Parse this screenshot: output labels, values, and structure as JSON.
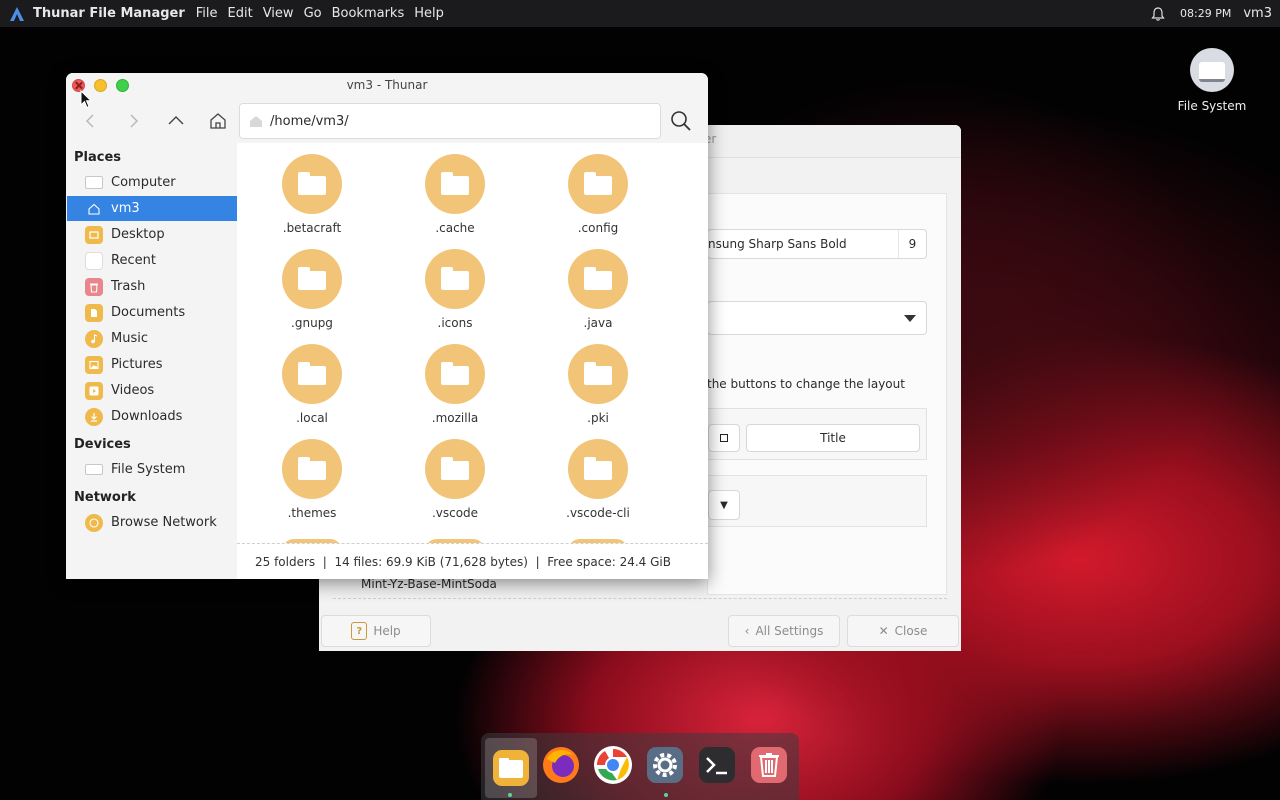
{
  "top_panel": {
    "app_title": "Thunar File Manager",
    "menu": [
      "File",
      "Edit",
      "View",
      "Go",
      "Bookmarks",
      "Help"
    ],
    "clock": "08:29 PM",
    "user": "vm3"
  },
  "desktop": {
    "icons": [
      {
        "label": "File System",
        "icon": "drive-icon"
      }
    ]
  },
  "settings_window": {
    "title_fragment": "er",
    "font_name": "nsung Sharp Sans Bold",
    "font_size": "9",
    "layout_hint": "the buttons to change the layout",
    "title_button": "Title",
    "theme_name": "Mint-Yz-Base-MintSoda",
    "buttons": {
      "help": "Help",
      "all_settings": "All Settings",
      "close": "Close"
    }
  },
  "thunar": {
    "title": "vm3 - Thunar",
    "path": "/home/vm3/",
    "sidebar": {
      "places_header": "Places",
      "places": [
        {
          "label": "Computer",
          "icon": "computer-icon"
        },
        {
          "label": "vm3",
          "icon": "home-icon",
          "selected": true
        },
        {
          "label": "Desktop",
          "icon": "desktop-icon"
        },
        {
          "label": "Recent",
          "icon": "recent-icon"
        },
        {
          "label": "Trash",
          "icon": "trash-icon"
        },
        {
          "label": "Documents",
          "icon": "documents-icon"
        },
        {
          "label": "Music",
          "icon": "music-icon"
        },
        {
          "label": "Pictures",
          "icon": "pictures-icon"
        },
        {
          "label": "Videos",
          "icon": "videos-icon"
        },
        {
          "label": "Downloads",
          "icon": "downloads-icon"
        }
      ],
      "devices_header": "Devices",
      "devices": [
        {
          "label": "File System",
          "icon": "drive-icon"
        }
      ],
      "network_header": "Network",
      "network": [
        {
          "label": "Browse Network",
          "icon": "network-icon"
        }
      ]
    },
    "folders": [
      ".betacraft",
      ".cache",
      ".config",
      ".gnupg",
      ".icons",
      ".java",
      ".local",
      ".mozilla",
      ".pki",
      ".themes",
      ".vscode",
      ".vscode-cli"
    ],
    "status": "25 folders  |  14 files: 69.9 KiB (71,628 bytes)  |  Free space: 24.4 GiB"
  },
  "dock": {
    "apps": [
      "files-icon",
      "firefox-icon",
      "chrome-icon",
      "settings-icon",
      "terminal-icon",
      "trash-icon"
    ]
  },
  "colors": {
    "selection": "#3584e4",
    "folder": "#f2c478",
    "panel": "#1b1b1d"
  }
}
